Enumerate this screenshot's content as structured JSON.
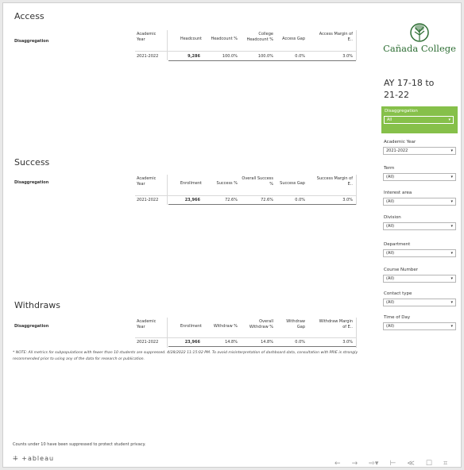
{
  "sections": {
    "access": {
      "title": "Access",
      "row_label": "Disaggregation",
      "headers": [
        "Academic Year",
        "Headcount",
        "Headcount %",
        "College Headcount %",
        "Access Gap",
        "Access Margin of E.."
      ],
      "row": {
        "year": "2021-2022",
        "values": [
          "9,286",
          "100.0%",
          "100.0%",
          "0.0%",
          "3.0%"
        ]
      }
    },
    "success": {
      "title": "Success",
      "row_label": "Disaggregation",
      "headers": [
        "Academic Year",
        "Enrollment",
        "Success %",
        "Overall Success %",
        "Success Gap",
        "Success Margin of E.."
      ],
      "row": {
        "year": "2021-2022",
        "values": [
          "23,966",
          "72.6%",
          "72.6%",
          "0.0%",
          "3.0%"
        ]
      }
    },
    "withdraws": {
      "title": "Withdraws",
      "row_label": "Disaggregation",
      "headers": [
        "Academic Year",
        "Enrollment",
        "Withdraw %",
        "Overall Withdraw %",
        "Withdraw Gap",
        "Withdraw Margin of E.."
      ],
      "row": {
        "year": "2021-2022",
        "values": [
          "23,966",
          "14.8%",
          "14.8%",
          "0.0%",
          "3.0%"
        ]
      }
    }
  },
  "note": "* NOTE: All metrics for subpopulations with fewer than 10 students are suppressed. 4/28/2022 11:15:02 PM. To avoid misinterpretation of dashboard data, consultation with PRIE is strongly recommended prior to using any of the data for research or publication.",
  "footer_note": "Counts under 10 have been suppressed to protect student privacy.",
  "tableau_logo": "+ableau",
  "college_logo": "Cañada College",
  "range_title": "AY 17-18 to 21-22",
  "filters": {
    "disaggregation": {
      "label": "Disaggregation",
      "value": "All"
    },
    "academic_year": {
      "label": "Academic Year",
      "value": "2021-2022"
    },
    "term": {
      "label": "Term",
      "value": "(All)"
    },
    "interest_area": {
      "label": "Interest area",
      "value": "(All)"
    },
    "division": {
      "label": "Division",
      "value": "(All)"
    },
    "department": {
      "label": "Department",
      "value": "(All)"
    },
    "course_number": {
      "label": "Course Number",
      "value": "(All)"
    },
    "contact_type": {
      "label": "Contact type",
      "value": "(All)"
    },
    "time_of_day": {
      "label": "Time of Day",
      "value": "(All)"
    }
  },
  "colors": {
    "accent_green": "#86c04a",
    "logo_green": "#2f6f35"
  },
  "toolbar_icons": [
    "undo-icon",
    "redo-icon",
    "revert-icon",
    "pause-icon",
    "share-icon",
    "comment-icon",
    "fullscreen-icon"
  ]
}
